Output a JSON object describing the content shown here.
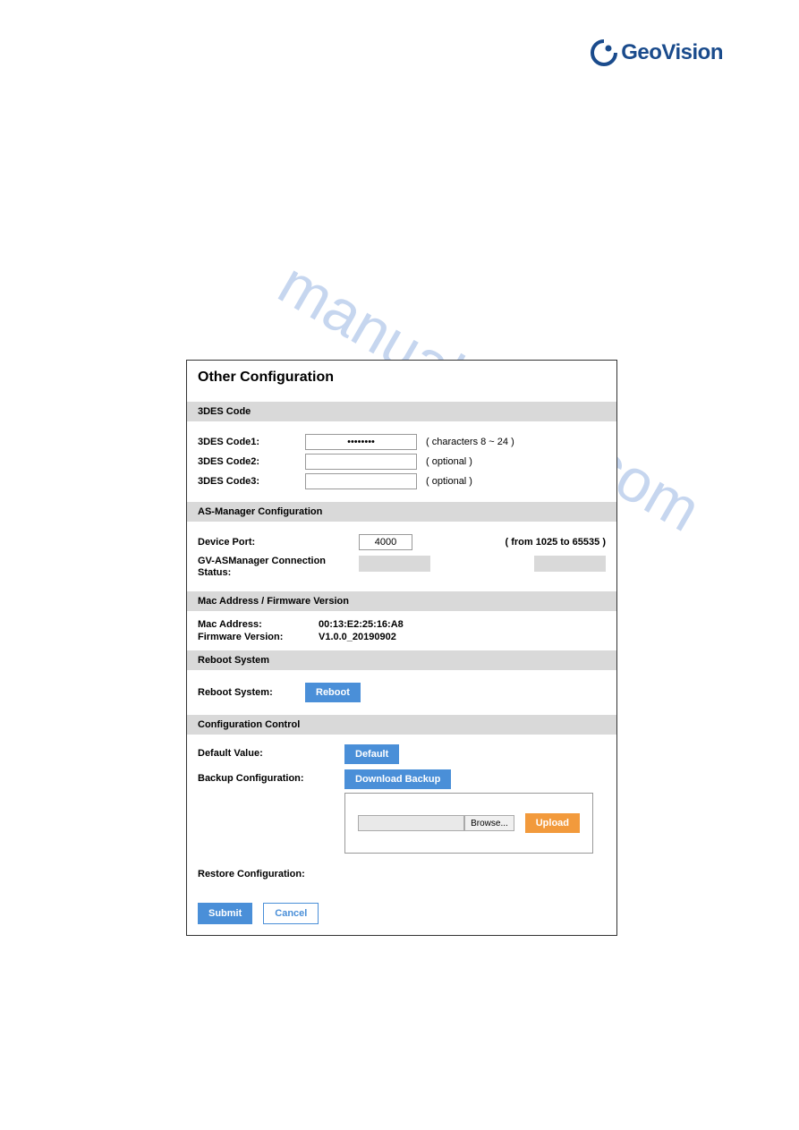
{
  "brand": {
    "name": "GeoVision"
  },
  "watermark": "manualshive.com",
  "panel": {
    "title": "Other Configuration",
    "des": {
      "header": "3DES Code",
      "rows": [
        {
          "label": "3DES Code1:",
          "value": "••••••••",
          "hint": "( characters 8 ~ 24 )"
        },
        {
          "label": "3DES Code2:",
          "value": "",
          "hint": "( optional )"
        },
        {
          "label": "3DES Code3:",
          "value": "",
          "hint": "( optional )"
        }
      ]
    },
    "asmgr": {
      "header": "AS-Manager Configuration",
      "port_label": "Device Port:",
      "port_value": "4000",
      "port_hint": "( from 1025 to 65535 )",
      "conn_label": "GV-ASManager Connection Status:"
    },
    "macfw": {
      "header": "Mac Address / Firmware Version",
      "mac_label": "Mac Address:",
      "mac_value": "00:13:E2:25:16:A8",
      "fw_label": "Firmware Version:",
      "fw_value": "V1.0.0_20190902"
    },
    "reboot": {
      "header": "Reboot System",
      "label": "Reboot System:",
      "button": "Reboot"
    },
    "cfgctl": {
      "header": "Configuration Control",
      "default_label": "Default Value:",
      "default_btn": "Default",
      "backup_label": "Backup Configuration:",
      "backup_btn": "Download Backup",
      "browse_btn": "Browse...",
      "upload_btn": "Upload",
      "restore_label": "Restore Configuration:"
    },
    "footer": {
      "submit": "Submit",
      "cancel": "Cancel"
    }
  }
}
